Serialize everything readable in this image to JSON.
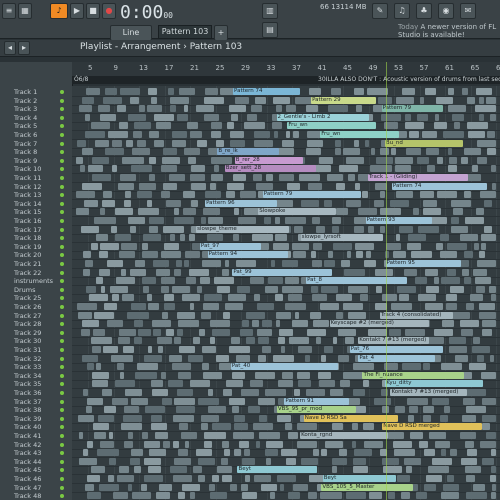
{
  "toolbar": {
    "time": "0:00",
    "time_small": "00",
    "tempo_label": "Line",
    "pattern": "Pattern 103",
    "mem": "13114 MB",
    "cpu": "66",
    "news_label": "Today",
    "news_text": "A newer version of FL Studio is available!"
  },
  "window": {
    "title": "Playlist - Arrangement",
    "separator": "›",
    "pattern": "Pattern 103"
  },
  "ruler": {
    "bars": [
      "5",
      "9",
      "13",
      "17",
      "21",
      "25",
      "29",
      "33",
      "37",
      "41",
      "45",
      "49",
      "53",
      "57",
      "61",
      "65",
      "69"
    ]
  },
  "markers": [
    {
      "text": "Ó6/8"
    },
    {
      "text": "30ILLA ALSO DON'T : Acoustic version of drums from last sect"
    }
  ],
  "tracks": [
    "Track 1",
    "Track 2",
    "Track 3",
    "Track 4",
    "Track 5",
    "Track 6",
    "Track 7",
    "Track 8",
    "Track 9",
    "Track 10",
    "Track 11",
    "Track 12",
    "Track 13",
    "Track 14",
    "Track 15",
    "Track 16",
    "Track 17",
    "Track 18",
    "Track 19",
    "Track 20",
    "Track 21",
    "Track 22",
    "instruments",
    "Drums",
    "Track 25",
    "Track 26",
    "Track 27",
    "Track 28",
    "Track 29",
    "Track 30",
    "Track 31",
    "Track 32",
    "Track 33",
    "Track 34",
    "Track 35",
    "Track 36",
    "Track 37",
    "Track 38",
    "Track 39",
    "Track 40",
    "Track 41",
    "Track 42",
    "Track 43",
    "Track 44",
    "Track 45",
    "Track 46",
    "Track 47",
    "Track 48"
  ],
  "clips": [
    {
      "t": 1,
      "l": "Pattern 74",
      "c": "#7bb6d6"
    },
    {
      "t": 2,
      "l": "Pattern 29",
      "c": "#c8d98a"
    },
    {
      "t": 3,
      "l": "Pattern 79",
      "c": "#7fb5a8"
    },
    {
      "t": 4,
      "l": "2_Gentle's - Limb 2",
      "c": "#9ad1d8"
    },
    {
      "t": 5,
      "l": "Fru_wn",
      "c": "#8ed0c6"
    },
    {
      "t": 6,
      "l": "Fru_wn",
      "c": "#8ed0c6"
    },
    {
      "t": 7,
      "l": "Bu_nd",
      "c": "#b5c46a"
    },
    {
      "t": 8,
      "l": "B_re_lk",
      "c": "#7fa6c8"
    },
    {
      "t": 9,
      "l": "B_rer_28",
      "c": "#c79ad0"
    },
    {
      "t": 10,
      "l": "Bzer_sett_28",
      "c": "#b58cc0"
    },
    {
      "t": 11,
      "l": "Track 1 - (Gliding)",
      "c": "#c3a3d1"
    },
    {
      "t": 12,
      "l": "Pattern 74",
      "c": "#9cc3d8"
    },
    {
      "t": 13,
      "l": "Pattern 79",
      "c": "#9cc3d8"
    },
    {
      "t": 14,
      "l": "Pattern 96",
      "c": "#9cc3d8"
    },
    {
      "t": 15,
      "l": "Slowpoke",
      "c": "#a7b8c0"
    },
    {
      "t": 16,
      "l": "Pattern 93",
      "c": "#9cc3d8"
    },
    {
      "t": 17,
      "l": "slowpe_theme",
      "c": "#a7b8c0"
    },
    {
      "t": 18,
      "l": "slowpe_lyrsoft",
      "c": "#a7b8c0"
    },
    {
      "t": 19,
      "l": "Pat_97",
      "c": "#9cc3d8"
    },
    {
      "t": 20,
      "l": "Pattern 94",
      "c": "#9cc3d8"
    },
    {
      "t": 21,
      "l": "Pattern 95",
      "c": "#9cc3d8"
    },
    {
      "t": 22,
      "l": "Pat_99",
      "c": "#9cc3d8"
    },
    {
      "t": 23,
      "l": "Pat_8",
      "c": "#9cc3d8"
    },
    {
      "t": 27,
      "l": "Track 4 (consolidated)",
      "c": "#a4b5bc"
    },
    {
      "t": 28,
      "l": "Keyscape #2 (merged)",
      "c": "#a4b5bc"
    },
    {
      "t": 30,
      "l": "Kontakt 7 #13 (merged)",
      "c": "#a4b5bc"
    },
    {
      "t": 31,
      "l": "Pat_76",
      "c": "#9cc3d8"
    },
    {
      "t": 32,
      "l": "Pat_4",
      "c": "#9cc3d8"
    },
    {
      "t": 33,
      "l": "Pat_40",
      "c": "#9cc3d8"
    },
    {
      "t": 34,
      "l": "The Fi_nuance",
      "c": "#a8d28a"
    },
    {
      "t": 35,
      "l": "Kyu_ditty",
      "c": "#8ec8d2"
    },
    {
      "t": 36,
      "l": "Kontakt 7 #13 (merged)",
      "c": "#a4b5bc"
    },
    {
      "t": 37,
      "l": "Pattern 91",
      "c": "#9cc3d8"
    },
    {
      "t": 38,
      "l": "VBS_95_pr_mod",
      "c": "#a8d28a"
    },
    {
      "t": 39,
      "l": "Nave D RSD Sa",
      "c": "#e0c15a"
    },
    {
      "t": 40,
      "l": "Nave D RSD merged",
      "c": "#e0c15a"
    },
    {
      "t": 41,
      "l": "Konta_rgnd",
      "c": "#a4b5bc"
    },
    {
      "t": 45,
      "l": "Beyt",
      "c": "#8ec8d2"
    },
    {
      "t": 46,
      "l": "Beyt",
      "c": "#8ec8d2"
    },
    {
      "t": 47,
      "l": "VBS_105_5_Master",
      "c": "#a8d28a"
    }
  ],
  "colors": {
    "accent": "#f08a24",
    "led": "#7ac943",
    "playhead": "#9fd34a"
  }
}
